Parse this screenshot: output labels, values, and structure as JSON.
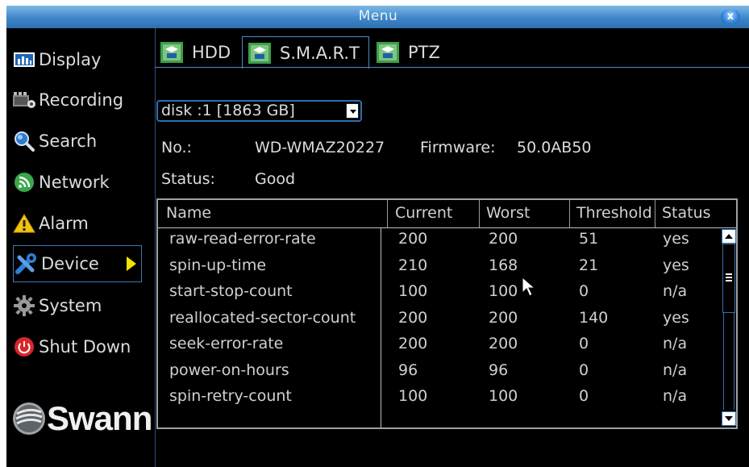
{
  "window": {
    "title": "Menu",
    "close_label": "x"
  },
  "sidebar": {
    "items": [
      {
        "label": "Display",
        "icon": "display-icon",
        "active": false
      },
      {
        "label": "Recording",
        "icon": "recording-icon",
        "active": false
      },
      {
        "label": "Search",
        "icon": "search-icon",
        "active": false
      },
      {
        "label": "Network",
        "icon": "network-icon",
        "active": false
      },
      {
        "label": "Alarm",
        "icon": "alarm-icon",
        "active": false
      },
      {
        "label": "Device",
        "icon": "device-icon",
        "active": true
      },
      {
        "label": "System",
        "icon": "system-icon",
        "active": false
      },
      {
        "label": "Shut Down",
        "icon": "power-icon",
        "active": false
      }
    ],
    "logo_text": "Swann"
  },
  "tabs": [
    {
      "label": "HDD",
      "active": false
    },
    {
      "label": "S.M.A.R.T",
      "active": true
    },
    {
      "label": "PTZ",
      "active": false
    }
  ],
  "disk_select": {
    "value": "disk :1 [1863 GB]"
  },
  "info": {
    "no_label": "No.:",
    "no_value": "WD-WMAZ20227",
    "firmware_label": "Firmware:",
    "firmware_value": "50.0AB50",
    "status_label": "Status:",
    "status_value": "Good"
  },
  "table": {
    "headers": {
      "name": "Name",
      "current": "Current",
      "worst": "Worst",
      "threshold": "Threshold",
      "status": "Status"
    },
    "rows": [
      {
        "name": "raw-read-error-rate",
        "current": "200",
        "worst": "200",
        "threshold": "51",
        "status": "yes"
      },
      {
        "name": "spin-up-time",
        "current": "210",
        "worst": "168",
        "threshold": "21",
        "status": "yes"
      },
      {
        "name": "start-stop-count",
        "current": "100",
        "worst": "100",
        "threshold": "0",
        "status": "n/a"
      },
      {
        "name": "reallocated-sector-count",
        "current": "200",
        "worst": "200",
        "threshold": "140",
        "status": "yes"
      },
      {
        "name": "seek-error-rate",
        "current": "200",
        "worst": "200",
        "threshold": "0",
        "status": "n/a"
      },
      {
        "name": "power-on-hours",
        "current": "96",
        "worst": "96",
        "threshold": "0",
        "status": "n/a"
      },
      {
        "name": "spin-retry-count",
        "current": "100",
        "worst": "100",
        "threshold": "0",
        "status": "n/a"
      }
    ]
  },
  "colors": {
    "title_bar": "#3e86c8",
    "accent": "#2d6fb0",
    "active_arrow": "#f4e300",
    "background": "#000000"
  }
}
